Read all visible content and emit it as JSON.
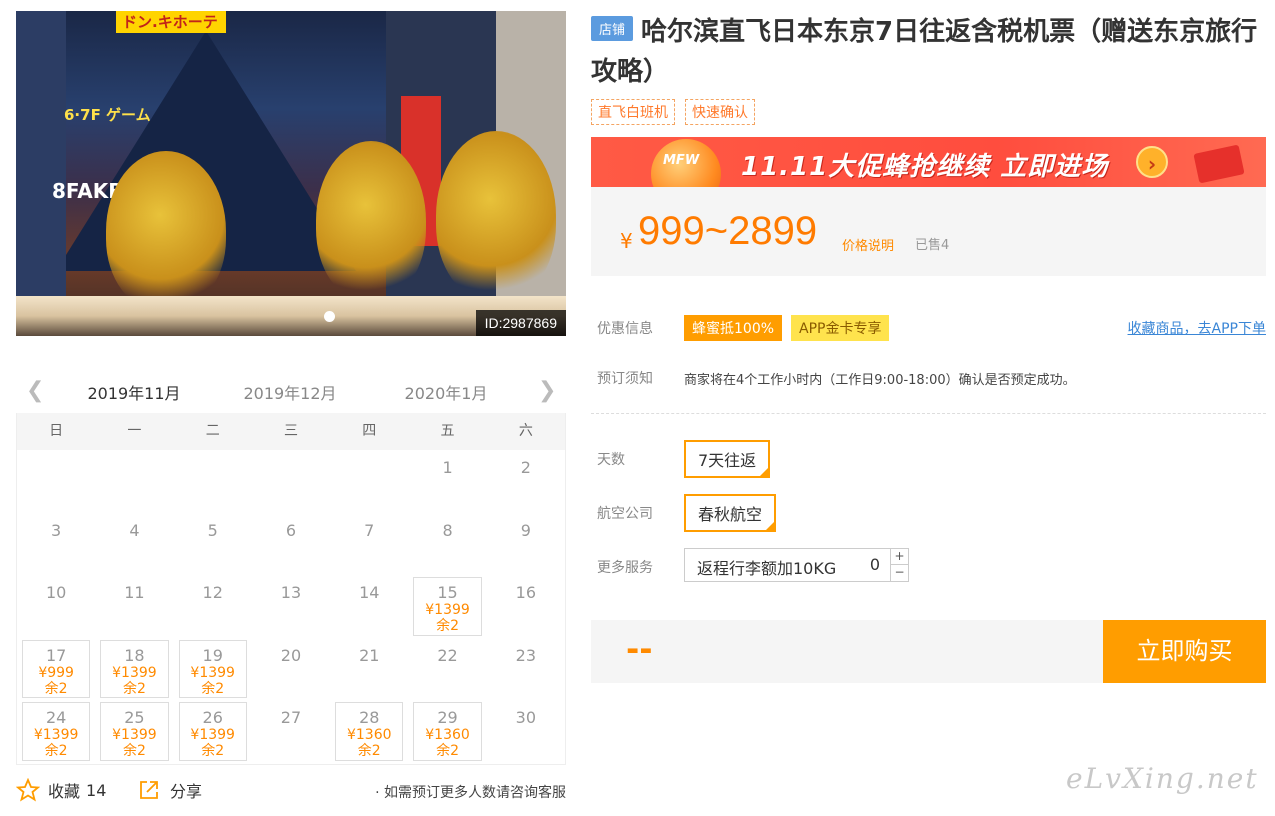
{
  "gallery": {
    "image_id": "ID:2987869",
    "signs": [
      "ドン.キホーテ",
      "6·7F ゲーム",
      "8FAKB"
    ]
  },
  "calendar": {
    "months": [
      "2019年11月",
      "2019年12月",
      "2020年1月"
    ],
    "active_month": 0,
    "weekdays": [
      "日",
      "一",
      "二",
      "三",
      "四",
      "五",
      "六"
    ],
    "weeks": [
      [
        {
          "d": ""
        },
        {
          "d": ""
        },
        {
          "d": ""
        },
        {
          "d": ""
        },
        {
          "d": ""
        },
        {
          "d": "1"
        },
        {
          "d": "2"
        }
      ],
      [
        {
          "d": "3"
        },
        {
          "d": "4"
        },
        {
          "d": "5"
        },
        {
          "d": "6"
        },
        {
          "d": "7"
        },
        {
          "d": "8"
        },
        {
          "d": "9"
        }
      ],
      [
        {
          "d": "10"
        },
        {
          "d": "11"
        },
        {
          "d": "12"
        },
        {
          "d": "13"
        },
        {
          "d": "14"
        },
        {
          "d": "15",
          "p": "¥1399",
          "r": "余2"
        },
        {
          "d": "16"
        }
      ],
      [
        {
          "d": "17",
          "p": "¥999",
          "r": "余2"
        },
        {
          "d": "18",
          "p": "¥1399",
          "r": "余2"
        },
        {
          "d": "19",
          "p": "¥1399",
          "r": "余2"
        },
        {
          "d": "20"
        },
        {
          "d": "21"
        },
        {
          "d": "22"
        },
        {
          "d": "23"
        }
      ],
      [
        {
          "d": "24",
          "p": "¥1399",
          "r": "余2"
        },
        {
          "d": "25",
          "p": "¥1399",
          "r": "余2"
        },
        {
          "d": "26",
          "p": "¥1399",
          "r": "余2"
        },
        {
          "d": "27"
        },
        {
          "d": "28",
          "p": "¥1360",
          "r": "余2"
        },
        {
          "d": "29",
          "p": "¥1360",
          "r": "余2"
        },
        {
          "d": "30"
        }
      ]
    ]
  },
  "footer": {
    "fav_label": "收藏",
    "fav_count": "14",
    "share_label": "分享",
    "hint": "· 如需预订更多人数请咨询客服"
  },
  "product": {
    "shop_tag": "店铺",
    "title": "哈尔滨直飞日本东京7日往返含税机票（赠送东京旅行攻略）",
    "tags": [
      "直飞白班机",
      "快速确认"
    ]
  },
  "banner": {
    "ball_text": "MFW",
    "text": "11.11大促蜂抢继续 立即进场",
    "go": "›"
  },
  "price": {
    "yen": "¥",
    "amount": "999~2899",
    "explain": "价格说明",
    "sold": "已售4"
  },
  "promo": {
    "label": "优惠信息",
    "badge1": "蜂蜜抵100%",
    "badge2": "APP金卡专享",
    "link": "收藏商品，去APP下单"
  },
  "booking": {
    "label": "预订须知",
    "notice": "商家将在4个工作小时内（工作日9:00-18:00）确认是否预定成功。"
  },
  "options": {
    "days_label": "天数",
    "days_value": "7天往返",
    "airline_label": "航空公司",
    "airline_value": "春秋航空",
    "service_label": "更多服务",
    "service_name": "返程行李额加10KG",
    "service_qty": "0",
    "plus": "+",
    "minus": "−"
  },
  "buy": {
    "total": "--",
    "button": "立即购买"
  },
  "watermark": "eLvXing.net"
}
